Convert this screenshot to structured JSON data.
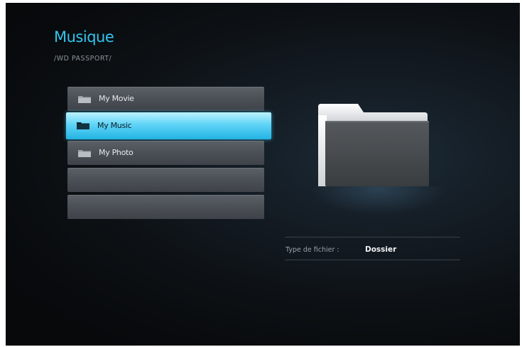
{
  "header": {
    "title": "Musique",
    "path": "/WD PASSPORT/"
  },
  "list": {
    "items": [
      {
        "label": "My Movie",
        "icon": "folder-icon",
        "selected": false
      },
      {
        "label": "My Music",
        "icon": "folder-icon",
        "selected": true
      },
      {
        "label": "My Photo",
        "icon": "folder-icon",
        "selected": false
      },
      {
        "label": "",
        "icon": "",
        "selected": false
      },
      {
        "label": "",
        "icon": "",
        "selected": false
      }
    ]
  },
  "preview": {
    "icon": "large-folder-icon"
  },
  "info": {
    "file_type_label": "Type de fichier :",
    "file_type_value": "Dossier"
  },
  "colors": {
    "accent": "#33c4ef",
    "selected_bg": "#22b3e3",
    "background": "#0d1115"
  }
}
